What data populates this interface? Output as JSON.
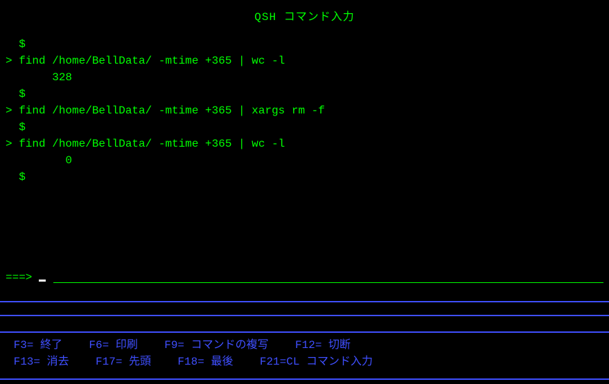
{
  "title": "QSH コマンド入力",
  "output": {
    "lines": [
      "  $",
      "> find /home/BellData/ -mtime +365 | wc -l",
      "       328",
      "  $",
      "> find /home/BellData/ -mtime +365 | xargs rm -f",
      "  $",
      "> find /home/BellData/ -mtime +365 | wc -l",
      "         0",
      "  $"
    ]
  },
  "input": {
    "prompt": "===> ",
    "value": ""
  },
  "fkeys": {
    "row1": " F3= 終了    F6= 印刷    F9= コマンドの複写    F12= 切断",
    "row2": " F13= 消去    F17= 先頭    F18= 最後    F21=CL コマンド入力"
  }
}
